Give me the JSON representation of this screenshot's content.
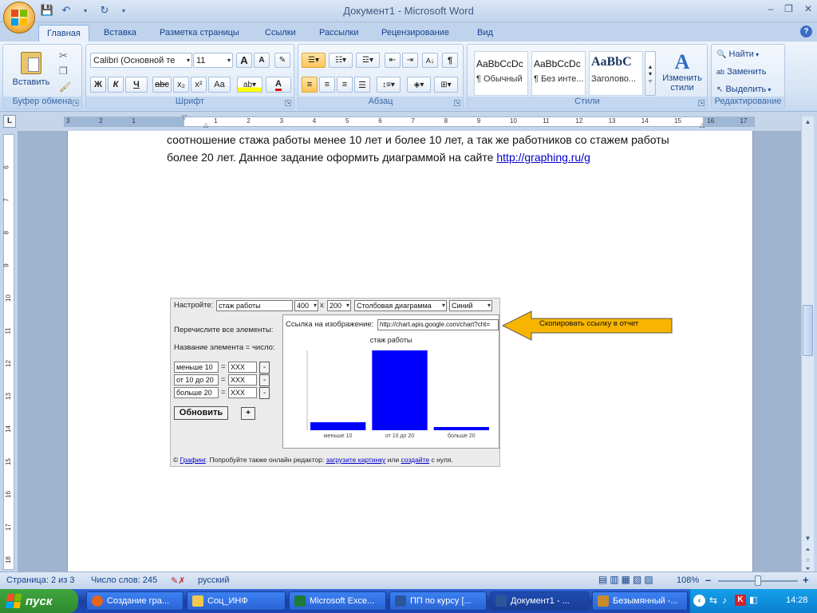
{
  "window": {
    "title": "Документ1 - Microsoft Word",
    "controls": [
      "–",
      "❐",
      "✕"
    ]
  },
  "tabs": [
    "Главная",
    "Вставка",
    "Разметка страницы",
    "Ссылки",
    "Рассылки",
    "Рецензирование",
    "Вид"
  ],
  "active_tab": "Главная",
  "ribbon": {
    "clipboard": {
      "label": "Буфер обмена",
      "paste": "Вставить"
    },
    "font": {
      "label": "Шрифт",
      "font_name": "Calibri (Основной те",
      "font_size": "11",
      "bold": "Ж",
      "italic": "К",
      "underline": "Ч",
      "strike": "abc",
      "sub": "x₂",
      "sup": "x²",
      "case": "Aa",
      "grow": "A",
      "shrink": "A",
      "font_color": "A"
    },
    "paragraph": {
      "label": "Абзац",
      "show_marks": "¶"
    },
    "styles": {
      "label": "Стили",
      "items": [
        {
          "sample": "AaBbCcDc",
          "name": "¶ Обычный"
        },
        {
          "sample": "AaBbCcDc",
          "name": "¶ Без инте..."
        },
        {
          "sample": "AaBbC",
          "name": "Заголово..."
        }
      ],
      "change": "Изменить стили"
    },
    "editing": {
      "label": "Редактирование",
      "find": "Найти",
      "replace": "Заменить",
      "select": "Выделить"
    }
  },
  "ruler": {
    "marks": [
      "3",
      "2",
      "1",
      "1",
      "2",
      "3",
      "4",
      "5",
      "6",
      "7",
      "8",
      "9",
      "10",
      "11",
      "12",
      "13",
      "14",
      "15",
      "16",
      "17"
    ],
    "vmarks": [
      "6",
      "7",
      "8",
      "9",
      "10",
      "11",
      "12",
      "13",
      "14",
      "15",
      "16",
      "17",
      "18",
      "19"
    ]
  },
  "document": {
    "line1": "соотношение стажа  работы менее 10 лет и более 10 лет, а так же работников со стажем работы",
    "line2_prefix": "более 20 лет.  Данное задание оформить диаграммой на сайте ",
    "link": "http://graphing.ru/g"
  },
  "embed": {
    "setup_label": "Настройте:",
    "chart_title_input": "стаж работы",
    "width": "400",
    "times": "x",
    "height": "200",
    "chart_type": "Столбовая диаграмма",
    "color": "Синий",
    "list_label": "Перечислите все элементы:",
    "format_label": "Название элемента = число:",
    "rows": [
      {
        "name": "меньше 10",
        "eq": "=",
        "value": "XXX",
        "remove": "-"
      },
      {
        "name": "от 10 до 20",
        "eq": "=",
        "value": "XXX",
        "remove": "-"
      },
      {
        "name": "больше 20",
        "eq": "=",
        "value": "XXX",
        "remove": "-"
      }
    ],
    "update_button": "Обновить",
    "add_button": "+",
    "link_label": "Ссылка на изображение:",
    "link_value": "http://chart.apis.google.com/chart?cht=",
    "footer_copyright": "© ",
    "footer_link1": "Графинг",
    "footer_text1": ". Попробуйте также онлайн редактор: ",
    "footer_link2": "загрузите картинку",
    "footer_text2": " или ",
    "footer_link3": "создайте",
    "footer_text3": " с нуля."
  },
  "chart_data": {
    "type": "bar",
    "title": "стаж работы",
    "categories": [
      "меньше 10",
      "от 10 до 20",
      "больше 20"
    ],
    "values": [
      10,
      100,
      4
    ],
    "ylim": [
      0,
      100
    ],
    "color": "#0000ff"
  },
  "callout": {
    "text": "Скопировать ссылку в отчет",
    "color": "#f7b500"
  },
  "statusbar": {
    "page": "Страница: 2 из 3",
    "words": "Число слов: 245",
    "language": "русский",
    "zoom": "108%",
    "zoom_minus": "–",
    "zoom_plus": "+"
  },
  "taskbar": {
    "start": "пуск",
    "items": [
      {
        "label": "Создание гра...",
        "color": "#e8641b"
      },
      {
        "label": "Соц_ИНФ",
        "color": "#f2c94c"
      },
      {
        "label": "Microsoft Exce...",
        "color": "#1f7a3a"
      },
      {
        "label": "ПП по курсу [...",
        "color": "#2b579a"
      },
      {
        "label": "Документ1 - ...",
        "color": "#2b579a"
      },
      {
        "label": "Безымянный -...",
        "color": "#c98a2b"
      }
    ],
    "lang": "RU",
    "time": "14:28"
  }
}
